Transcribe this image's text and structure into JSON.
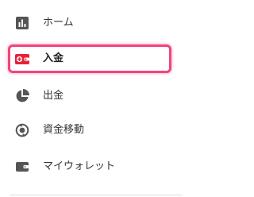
{
  "menu": {
    "items": [
      {
        "label": "ホーム",
        "icon": "bar-chart-icon",
        "active": false
      },
      {
        "label": "入金",
        "icon": "deposit-wallet-icon",
        "active": true
      },
      {
        "label": "出金",
        "icon": "pie-chart-icon",
        "active": false
      },
      {
        "label": "資金移動",
        "icon": "transfer-icon",
        "active": false
      },
      {
        "label": "マイウォレット",
        "icon": "wallet-icon",
        "active": false
      }
    ]
  },
  "colors": {
    "icon": "#555555",
    "active_icon": "#e8203a",
    "highlight_border": "#f0457b",
    "text": "#333333"
  }
}
